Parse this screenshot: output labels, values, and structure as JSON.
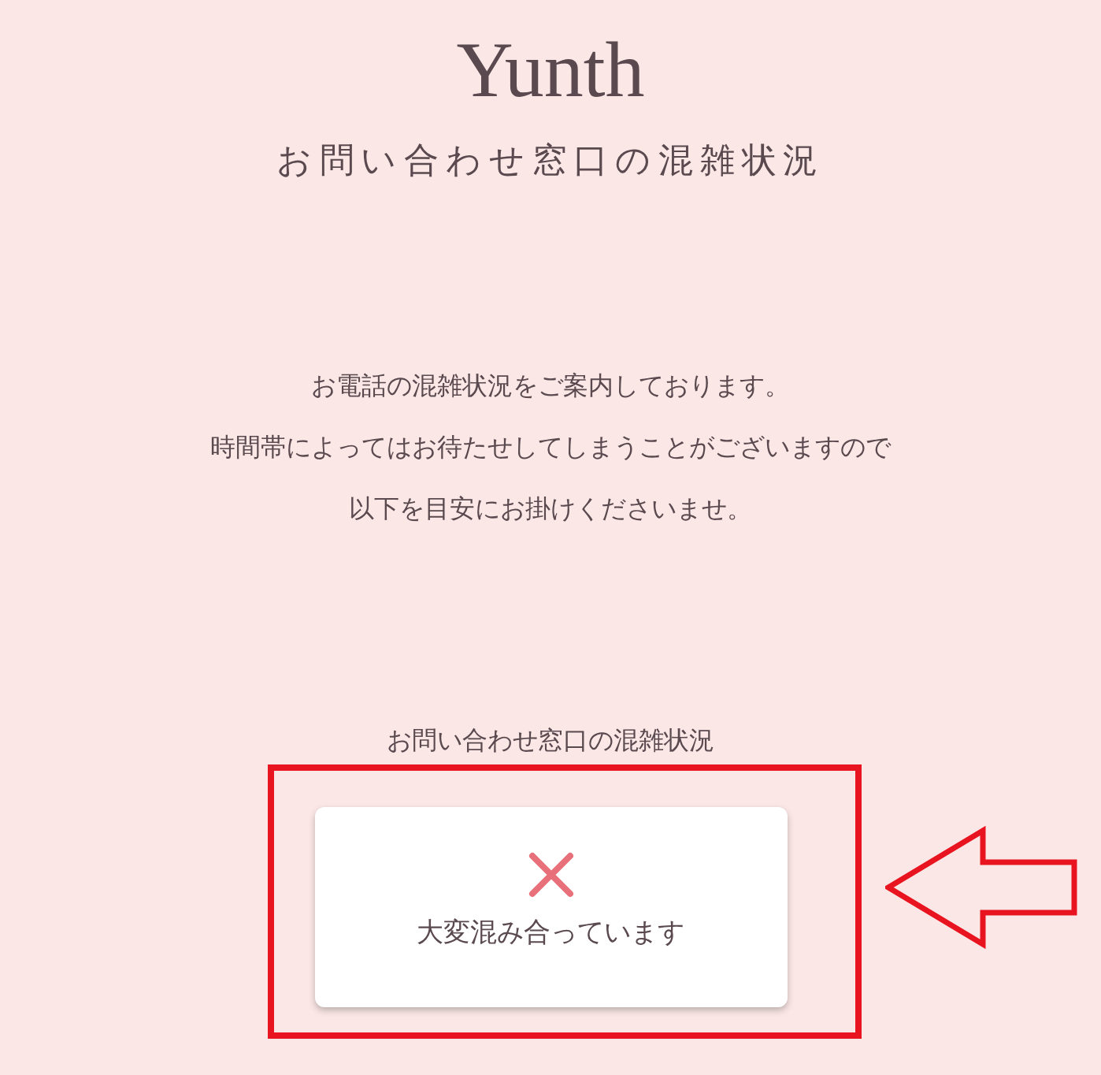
{
  "logo": "Yunth",
  "heading": "お問い合わせ窓口の混雑状況",
  "intro": [
    "お電話の混雑状況をご案内しております。",
    "時間帯によってはお待たせしてしまうことがございますので",
    "以下を目安にお掛けくださいませ。"
  ],
  "status_label": "お問い合わせ窓口の混雑状況",
  "status": {
    "kind": "busy",
    "text": "大変混み合っています"
  },
  "annotations": {
    "highlight_box": true,
    "arrow": true
  }
}
